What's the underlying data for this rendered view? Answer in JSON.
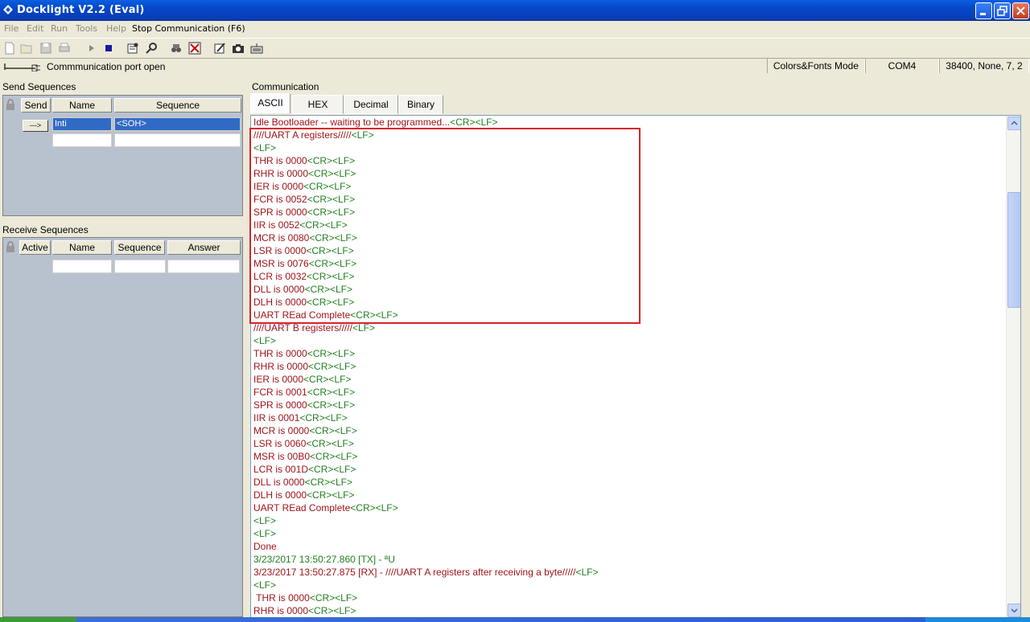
{
  "window": {
    "title": "Docklight V2.2 (Eval)"
  },
  "menu": {
    "items": [
      "File",
      "Edit",
      "Run",
      "Tools",
      "Help"
    ],
    "stop": "Stop Communication  (F6)"
  },
  "status": {
    "message": "Commmunication port open",
    "mode": "Colors&Fonts Mode",
    "port": "COM4",
    "settings": "38400, None, 7, 2"
  },
  "send": {
    "label": "Send Sequences",
    "headers": {
      "send": "Send",
      "name": "Name",
      "sequence": "Sequence"
    },
    "button": "--->",
    "rows": [
      {
        "name": "Inti",
        "sequence": "<SOH>"
      }
    ]
  },
  "receive": {
    "label": "Receive Sequences",
    "headers": {
      "active": "Active",
      "name": "Name",
      "sequence": "Sequence",
      "answer": "Answer"
    }
  },
  "communication": {
    "label": "Communication",
    "tabs": [
      "ASCII",
      "HEX",
      "Decimal",
      "Binary"
    ],
    "active_tab": "ASCII",
    "colors": {
      "rx": "#a0141b",
      "tx": "#217e20",
      "highlight": "#d8222b"
    },
    "lines": [
      [
        {
          "t": "Idle Bootloader -- waiting to be programmed...",
          "c": "rx"
        },
        {
          "t": "<CR><LF>",
          "c": "tx"
        }
      ],
      [
        {
          "t": "////UART A registers/////",
          "c": "rx"
        },
        {
          "t": "<LF>",
          "c": "tx"
        }
      ],
      [
        {
          "t": "<LF>",
          "c": "tx"
        }
      ],
      [
        {
          "t": "THR is 0000",
          "c": "rx"
        },
        {
          "t": "<CR><LF>",
          "c": "tx"
        }
      ],
      [
        {
          "t": "RHR is 0000",
          "c": "rx"
        },
        {
          "t": "<CR><LF>",
          "c": "tx"
        }
      ],
      [
        {
          "t": "IER is 0000",
          "c": "rx"
        },
        {
          "t": "<CR><LF>",
          "c": "tx"
        }
      ],
      [
        {
          "t": "FCR is 0052",
          "c": "rx"
        },
        {
          "t": "<CR><LF>",
          "c": "tx"
        }
      ],
      [
        {
          "t": "SPR is 0000",
          "c": "rx"
        },
        {
          "t": "<CR><LF>",
          "c": "tx"
        }
      ],
      [
        {
          "t": "IIR is 0052",
          "c": "rx"
        },
        {
          "t": "<CR><LF>",
          "c": "tx"
        }
      ],
      [
        {
          "t": "MCR is 0080",
          "c": "rx"
        },
        {
          "t": "<CR><LF>",
          "c": "tx"
        }
      ],
      [
        {
          "t": "LSR is 0000",
          "c": "rx"
        },
        {
          "t": "<CR><LF>",
          "c": "tx"
        }
      ],
      [
        {
          "t": "MSR is 0076",
          "c": "rx"
        },
        {
          "t": "<CR><LF>",
          "c": "tx"
        }
      ],
      [
        {
          "t": "LCR is 0032",
          "c": "rx"
        },
        {
          "t": "<CR><LF>",
          "c": "tx"
        }
      ],
      [
        {
          "t": "DLL is 0000",
          "c": "rx"
        },
        {
          "t": "<CR><LF>",
          "c": "tx"
        }
      ],
      [
        {
          "t": "DLH is 0000",
          "c": "rx"
        },
        {
          "t": "<CR><LF>",
          "c": "tx"
        }
      ],
      [
        {
          "t": "UART REad Complete",
          "c": "rx"
        },
        {
          "t": "<CR><LF>",
          "c": "tx"
        }
      ],
      [
        {
          "t": "////UART B registers/////",
          "c": "rx"
        },
        {
          "t": "<LF>",
          "c": "tx"
        }
      ],
      [
        {
          "t": "<LF>",
          "c": "tx"
        }
      ],
      [
        {
          "t": "THR is 0000",
          "c": "rx"
        },
        {
          "t": "<CR><LF>",
          "c": "tx"
        }
      ],
      [
        {
          "t": "RHR is 0000",
          "c": "rx"
        },
        {
          "t": "<CR><LF>",
          "c": "tx"
        }
      ],
      [
        {
          "t": "IER is 0000",
          "c": "rx"
        },
        {
          "t": "<CR><LF>",
          "c": "tx"
        }
      ],
      [
        {
          "t": "FCR is 0001",
          "c": "rx"
        },
        {
          "t": "<CR><LF>",
          "c": "tx"
        }
      ],
      [
        {
          "t": "SPR is 0000",
          "c": "rx"
        },
        {
          "t": "<CR><LF>",
          "c": "tx"
        }
      ],
      [
        {
          "t": "IIR is 0001",
          "c": "rx"
        },
        {
          "t": "<CR><LF>",
          "c": "tx"
        }
      ],
      [
        {
          "t": "MCR is 0000",
          "c": "rx"
        },
        {
          "t": "<CR><LF>",
          "c": "tx"
        }
      ],
      [
        {
          "t": "LSR is 0060",
          "c": "rx"
        },
        {
          "t": "<CR><LF>",
          "c": "tx"
        }
      ],
      [
        {
          "t": "MSR is 00B0",
          "c": "rx"
        },
        {
          "t": "<CR><LF>",
          "c": "tx"
        }
      ],
      [
        {
          "t": "LCR is 001D",
          "c": "rx"
        },
        {
          "t": "<CR><LF>",
          "c": "tx"
        }
      ],
      [
        {
          "t": "DLL is 0000",
          "c": "rx"
        },
        {
          "t": "<CR><LF>",
          "c": "tx"
        }
      ],
      [
        {
          "t": "DLH is 0000",
          "c": "rx"
        },
        {
          "t": "<CR><LF>",
          "c": "tx"
        }
      ],
      [
        {
          "t": "UART REad Complete",
          "c": "rx"
        },
        {
          "t": "<CR><LF>",
          "c": "tx"
        }
      ],
      [
        {
          "t": "<LF>",
          "c": "tx"
        }
      ],
      [
        {
          "t": "<LF>",
          "c": "tx"
        }
      ],
      [
        {
          "t": "Done",
          "c": "rx"
        }
      ],
      [
        {
          "t": "3/23/2017 13:50:27.860 [TX] - ªU",
          "c": "tx"
        }
      ],
      [
        {
          "t": "3/23/2017 13:50:27.875 [RX] - ////UART A registers after receiving a byte/////",
          "c": "rx"
        },
        {
          "t": "<LF>",
          "c": "tx"
        }
      ],
      [
        {
          "t": "<LF>",
          "c": "tx"
        }
      ],
      [
        {
          "t": " THR is 0000",
          "c": "rx"
        },
        {
          "t": "<CR><LF>",
          "c": "tx"
        }
      ],
      [
        {
          "t": "RHR is 0000",
          "c": "rx"
        },
        {
          "t": "<CR><LF>",
          "c": "tx"
        }
      ]
    ]
  },
  "icons": [
    "app-icon",
    "new-icon",
    "open-icon",
    "save-icon",
    "print-icon",
    "run-icon",
    "stop-icon",
    "settings-icon",
    "search-icon",
    "find-icon",
    "clear-icon",
    "edit-icon",
    "camera-icon",
    "keyboard-icon",
    "plug-icon",
    "lock-icon"
  ]
}
